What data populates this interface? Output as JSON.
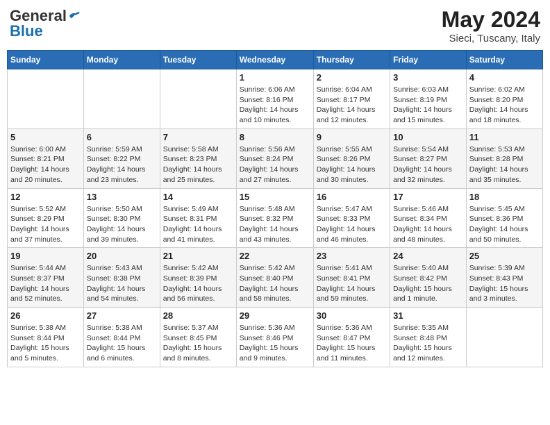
{
  "header": {
    "logo_general": "General",
    "logo_blue": "Blue",
    "title": "May 2024",
    "subtitle": "Sieci, Tuscany, Italy"
  },
  "weekdays": [
    "Sunday",
    "Monday",
    "Tuesday",
    "Wednesday",
    "Thursday",
    "Friday",
    "Saturday"
  ],
  "weeks": [
    [
      {
        "day": "",
        "info": ""
      },
      {
        "day": "",
        "info": ""
      },
      {
        "day": "",
        "info": ""
      },
      {
        "day": "1",
        "info": "Sunrise: 6:06 AM\nSunset: 8:16 PM\nDaylight: 14 hours\nand 10 minutes."
      },
      {
        "day": "2",
        "info": "Sunrise: 6:04 AM\nSunset: 8:17 PM\nDaylight: 14 hours\nand 12 minutes."
      },
      {
        "day": "3",
        "info": "Sunrise: 6:03 AM\nSunset: 8:19 PM\nDaylight: 14 hours\nand 15 minutes."
      },
      {
        "day": "4",
        "info": "Sunrise: 6:02 AM\nSunset: 8:20 PM\nDaylight: 14 hours\nand 18 minutes."
      }
    ],
    [
      {
        "day": "5",
        "info": "Sunrise: 6:00 AM\nSunset: 8:21 PM\nDaylight: 14 hours\nand 20 minutes."
      },
      {
        "day": "6",
        "info": "Sunrise: 5:59 AM\nSunset: 8:22 PM\nDaylight: 14 hours\nand 23 minutes."
      },
      {
        "day": "7",
        "info": "Sunrise: 5:58 AM\nSunset: 8:23 PM\nDaylight: 14 hours\nand 25 minutes."
      },
      {
        "day": "8",
        "info": "Sunrise: 5:56 AM\nSunset: 8:24 PM\nDaylight: 14 hours\nand 27 minutes."
      },
      {
        "day": "9",
        "info": "Sunrise: 5:55 AM\nSunset: 8:26 PM\nDaylight: 14 hours\nand 30 minutes."
      },
      {
        "day": "10",
        "info": "Sunrise: 5:54 AM\nSunset: 8:27 PM\nDaylight: 14 hours\nand 32 minutes."
      },
      {
        "day": "11",
        "info": "Sunrise: 5:53 AM\nSunset: 8:28 PM\nDaylight: 14 hours\nand 35 minutes."
      }
    ],
    [
      {
        "day": "12",
        "info": "Sunrise: 5:52 AM\nSunset: 8:29 PM\nDaylight: 14 hours\nand 37 minutes."
      },
      {
        "day": "13",
        "info": "Sunrise: 5:50 AM\nSunset: 8:30 PM\nDaylight: 14 hours\nand 39 minutes."
      },
      {
        "day": "14",
        "info": "Sunrise: 5:49 AM\nSunset: 8:31 PM\nDaylight: 14 hours\nand 41 minutes."
      },
      {
        "day": "15",
        "info": "Sunrise: 5:48 AM\nSunset: 8:32 PM\nDaylight: 14 hours\nand 43 minutes."
      },
      {
        "day": "16",
        "info": "Sunrise: 5:47 AM\nSunset: 8:33 PM\nDaylight: 14 hours\nand 46 minutes."
      },
      {
        "day": "17",
        "info": "Sunrise: 5:46 AM\nSunset: 8:34 PM\nDaylight: 14 hours\nand 48 minutes."
      },
      {
        "day": "18",
        "info": "Sunrise: 5:45 AM\nSunset: 8:36 PM\nDaylight: 14 hours\nand 50 minutes."
      }
    ],
    [
      {
        "day": "19",
        "info": "Sunrise: 5:44 AM\nSunset: 8:37 PM\nDaylight: 14 hours\nand 52 minutes."
      },
      {
        "day": "20",
        "info": "Sunrise: 5:43 AM\nSunset: 8:38 PM\nDaylight: 14 hours\nand 54 minutes."
      },
      {
        "day": "21",
        "info": "Sunrise: 5:42 AM\nSunset: 8:39 PM\nDaylight: 14 hours\nand 56 minutes."
      },
      {
        "day": "22",
        "info": "Sunrise: 5:42 AM\nSunset: 8:40 PM\nDaylight: 14 hours\nand 58 minutes."
      },
      {
        "day": "23",
        "info": "Sunrise: 5:41 AM\nSunset: 8:41 PM\nDaylight: 14 hours\nand 59 minutes."
      },
      {
        "day": "24",
        "info": "Sunrise: 5:40 AM\nSunset: 8:42 PM\nDaylight: 15 hours\nand 1 minute."
      },
      {
        "day": "25",
        "info": "Sunrise: 5:39 AM\nSunset: 8:43 PM\nDaylight: 15 hours\nand 3 minutes."
      }
    ],
    [
      {
        "day": "26",
        "info": "Sunrise: 5:38 AM\nSunset: 8:44 PM\nDaylight: 15 hours\nand 5 minutes."
      },
      {
        "day": "27",
        "info": "Sunrise: 5:38 AM\nSunset: 8:44 PM\nDaylight: 15 hours\nand 6 minutes."
      },
      {
        "day": "28",
        "info": "Sunrise: 5:37 AM\nSunset: 8:45 PM\nDaylight: 15 hours\nand 8 minutes."
      },
      {
        "day": "29",
        "info": "Sunrise: 5:36 AM\nSunset: 8:46 PM\nDaylight: 15 hours\nand 9 minutes."
      },
      {
        "day": "30",
        "info": "Sunrise: 5:36 AM\nSunset: 8:47 PM\nDaylight: 15 hours\nand 11 minutes."
      },
      {
        "day": "31",
        "info": "Sunrise: 5:35 AM\nSunset: 8:48 PM\nDaylight: 15 hours\nand 12 minutes."
      },
      {
        "day": "",
        "info": ""
      }
    ]
  ]
}
